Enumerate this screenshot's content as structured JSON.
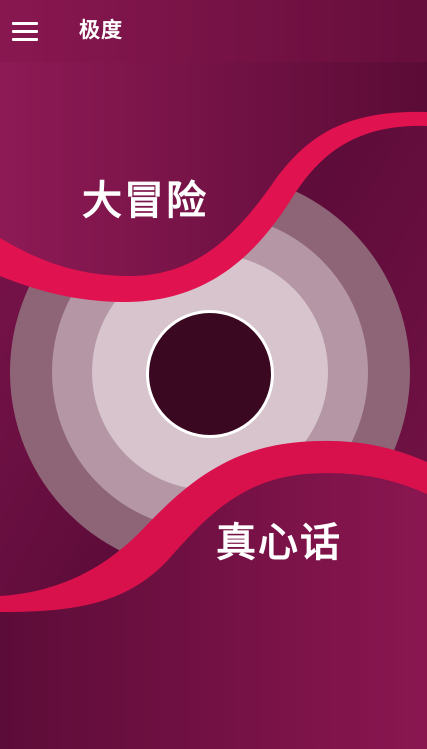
{
  "header": {
    "title": "极度",
    "menu_icon": "hamburger-menu-icon"
  },
  "options": {
    "dare_label": "大冒险",
    "truth_label": "真心话"
  },
  "colors": {
    "background": "#6e0f45",
    "ribbon_accent": "#e0124f",
    "ring_outer": "#a07f8f",
    "ring_inner": "#d9c6cf",
    "center": "#3b0822",
    "text": "#ffffff"
  }
}
